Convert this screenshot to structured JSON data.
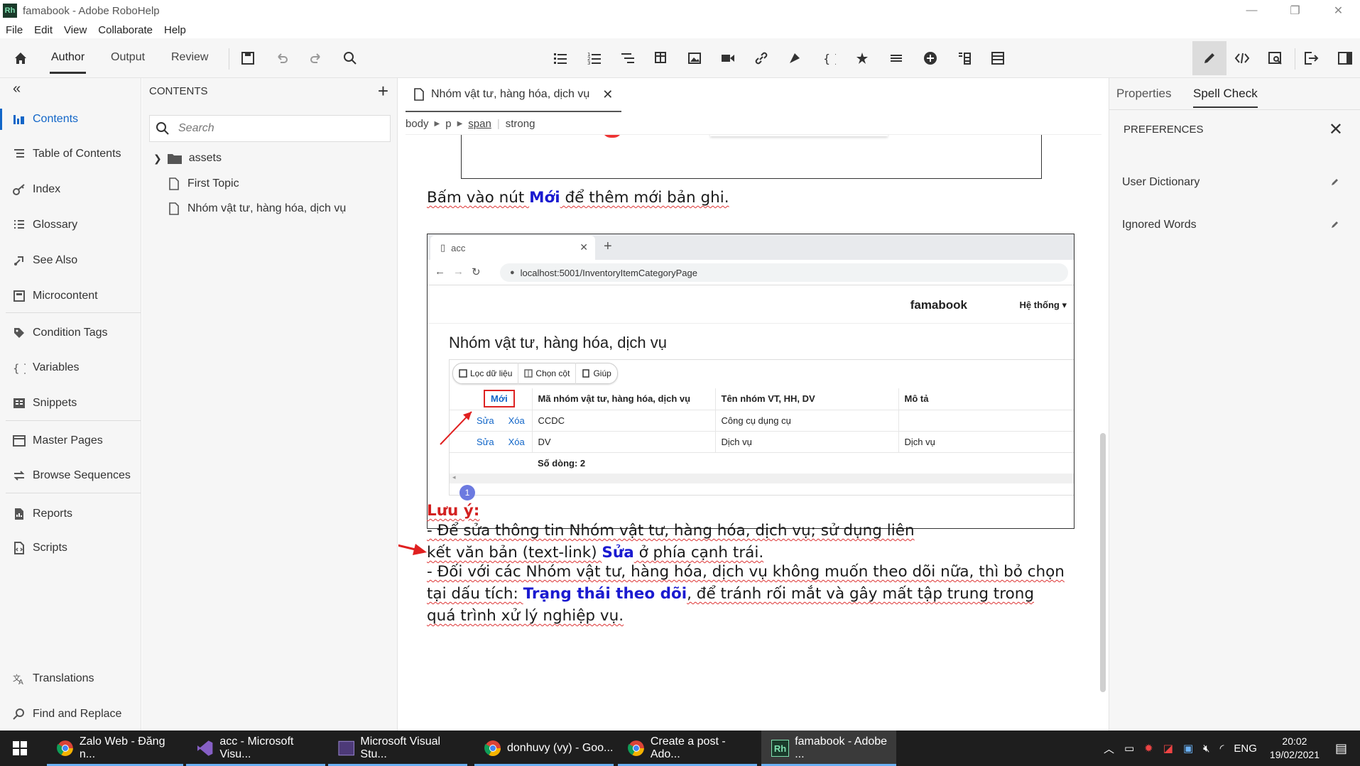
{
  "window": {
    "title": "famabook - Adobe RoboHelp",
    "logo": "Rh"
  },
  "menu": [
    "File",
    "Edit",
    "View",
    "Collaborate",
    "Help"
  ],
  "toolbar": {
    "modes": [
      "Author",
      "Output",
      "Review"
    ],
    "active_mode": "Author"
  },
  "left_nav": {
    "items": [
      {
        "label": "Contents",
        "icon": "contents-icon"
      },
      {
        "label": "Table of Contents",
        "icon": "toc-icon"
      },
      {
        "label": "Index",
        "icon": "key-icon"
      },
      {
        "label": "Glossary",
        "icon": "glossary-icon"
      },
      {
        "label": "See Also",
        "icon": "see-also-icon"
      },
      {
        "label": "Microcontent",
        "icon": "microcontent-icon"
      },
      {
        "label": "Condition Tags",
        "icon": "tag-icon"
      },
      {
        "label": "Variables",
        "icon": "braces-icon"
      },
      {
        "label": "Snippets",
        "icon": "snippet-icon"
      },
      {
        "label": "Master Pages",
        "icon": "master-page-icon"
      },
      {
        "label": "Browse Sequences",
        "icon": "browse-sequence-icon"
      },
      {
        "label": "Reports",
        "icon": "report-icon"
      },
      {
        "label": "Scripts",
        "icon": "script-icon"
      },
      {
        "label": "Translations",
        "icon": "translate-icon"
      },
      {
        "label": "Find and Replace",
        "icon": "find-replace-icon"
      }
    ]
  },
  "contents_panel": {
    "heading": "CONTENTS",
    "search_placeholder": "Search",
    "tree": [
      "assets",
      "First Topic",
      "Nhóm vật tư, hàng hóa, dịch vụ"
    ]
  },
  "editor": {
    "tab_title": "Nhóm vật tư, hàng hóa, dịch vụ",
    "breadcrumb": [
      "body",
      "p",
      "span",
      "strong"
    ],
    "para1": {
      "pre": "Bấm vào nút ",
      "hl": "Mới",
      "post": " để thêm mới bản ghi."
    },
    "note_label": "Lưu ý:",
    "note1": {
      "pre": "- Để sửa thông tin Nhóm vật tư, hàng hóa, dịch vụ; sử dụng liên kết văn bản (text-link) ",
      "hl": "Sửa",
      "post": " ở phía cạnh trái."
    },
    "note2": {
      "pre": "- Đối với các Nhóm vật tư, hàng hóa, dịch vụ không muốn theo dõi nữa, thì bỏ chọn tại dấu tích: ",
      "hl": "Trạng thái theo dõi",
      "post": ", để tránh rối mắt và gây mất tập trung trong quá trình xử lý nghiệp vụ."
    }
  },
  "screenshot": {
    "tab": "acc",
    "url": "localhost:5001/InventoryItemCategoryPage",
    "brand": "famabook",
    "system_menu": "Hệ thống",
    "page_title": "Nhóm vật tư, hàng hóa, dịch vụ",
    "buttons": [
      "Lọc dữ liệu",
      "Chọn cột",
      "Giúp"
    ],
    "new_button": "Mới",
    "columns": [
      "Mã nhóm vật tư, hàng hóa, dịch vụ",
      "Tên nhóm VT, HH, DV",
      "Mô tả"
    ],
    "rows": [
      {
        "edit": "Sửa",
        "delete": "Xóa",
        "code": "CCDC",
        "name": "Công cụ dụng cụ",
        "desc": ""
      },
      {
        "edit": "Sửa",
        "delete": "Xóa",
        "code": "DV",
        "name": "Dịch vụ",
        "desc": "Dịch vụ"
      }
    ],
    "row_count": "Số dòng: 2",
    "page": "1"
  },
  "right_panel": {
    "tabs": [
      "Properties",
      "Spell Check"
    ],
    "active_tab": "Spell Check",
    "heading": "PREFERENCES",
    "items": [
      "User Dictionary",
      "Ignored Words"
    ]
  },
  "taskbar": {
    "tasks": [
      "Zalo Web - Đăng n...",
      "acc - Microsoft Visu...",
      "Microsoft Visual Stu...",
      "donhuvy (vy) - Goo...",
      "Create a post - Ado...",
      "famabook - Adobe ..."
    ],
    "lang": "ENG",
    "time": "20:02",
    "date": "19/02/2021"
  },
  "colors": {
    "accent": "#1266c8",
    "highlight": "#1a1ad0",
    "note": "#d32020"
  }
}
